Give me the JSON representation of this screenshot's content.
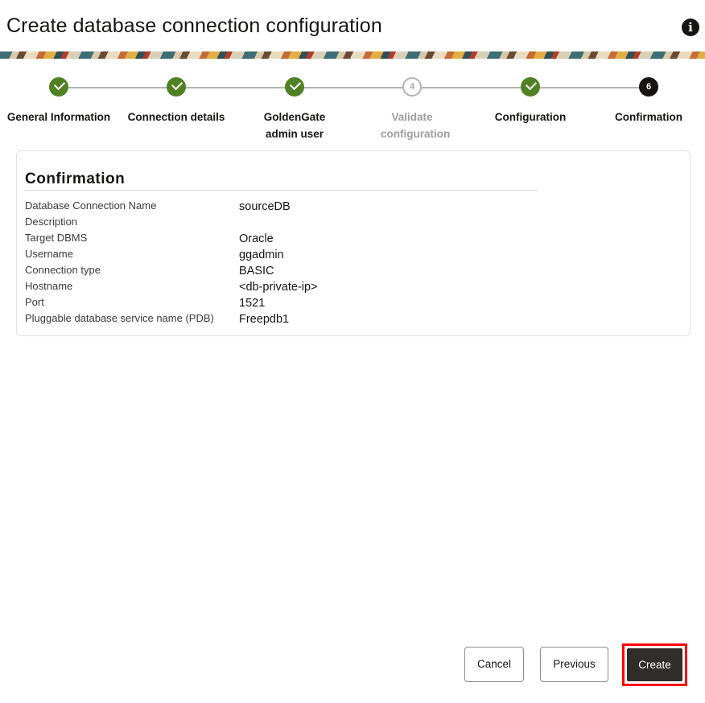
{
  "header": {
    "title": "Create database connection configuration",
    "info_icon": "info-icon"
  },
  "train": {
    "steps": [
      {
        "label": "General Information",
        "state": "done"
      },
      {
        "label": "Connection details",
        "state": "done"
      },
      {
        "label": "GoldenGate admin user",
        "state": "done"
      },
      {
        "label": "Validate configuration",
        "state": "pending",
        "number": "4"
      },
      {
        "label": "Configuration",
        "state": "done"
      },
      {
        "label": "Confirmation",
        "state": "current",
        "number": "6"
      }
    ]
  },
  "confirmation": {
    "title": "Confirmation",
    "rows": [
      {
        "label": "Database Connection Name",
        "value": "sourceDB"
      },
      {
        "label": "Description",
        "value": ""
      },
      {
        "label": "Target DBMS",
        "value": "Oracle"
      },
      {
        "label": "Username",
        "value": "ggadmin"
      },
      {
        "label": "Connection type",
        "value": "BASIC"
      },
      {
        "label": "Hostname",
        "value": "<db-private-ip>"
      },
      {
        "label": "Port",
        "value": "1521"
      },
      {
        "label": "Pluggable database service name (PDB)",
        "value": "Freepdb1"
      }
    ]
  },
  "footer": {
    "cancel_label": "Cancel",
    "previous_label": "Previous",
    "create_label": "Create"
  },
  "colors": {
    "step_done": "#508223",
    "step_current": "#161513",
    "primary_button": "#312d2a",
    "highlight": "#ff0000"
  }
}
